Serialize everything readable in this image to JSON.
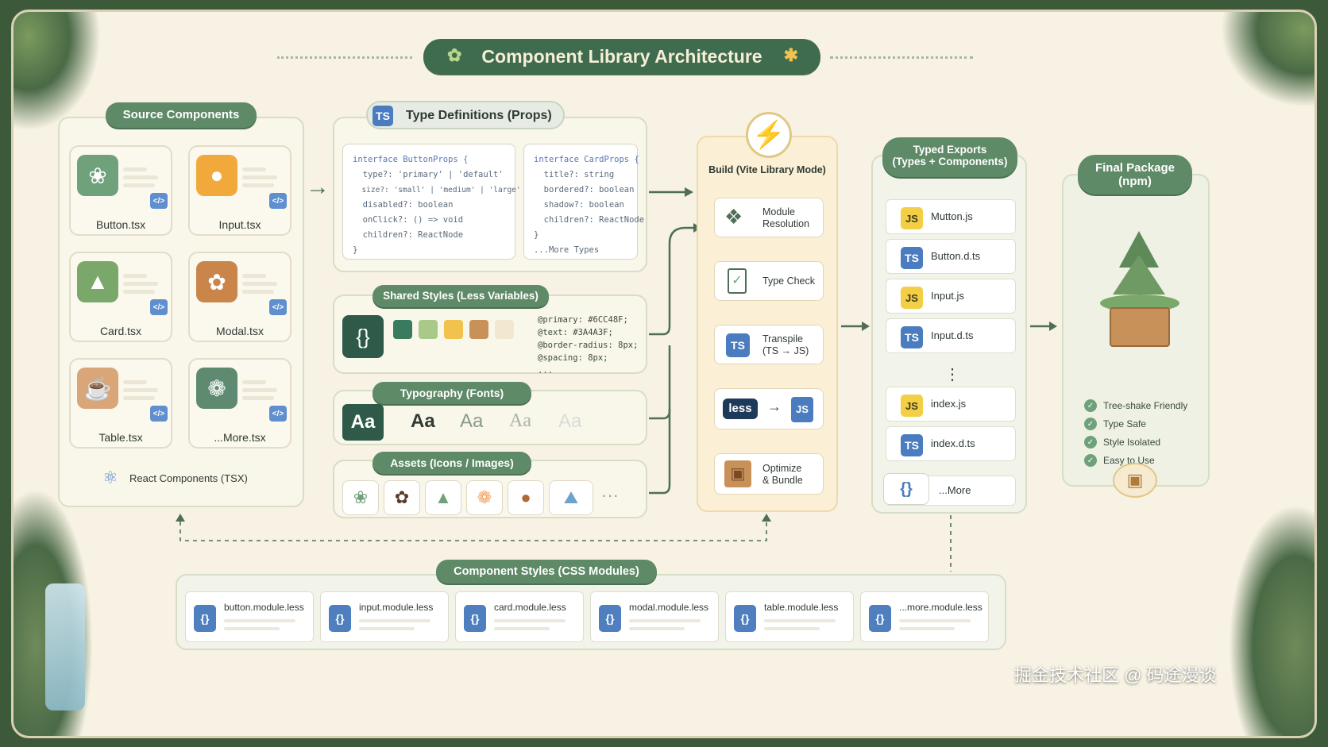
{
  "title": "Component Library Architecture",
  "source": {
    "heading": "Source Components",
    "items": [
      {
        "label": "Button.tsx",
        "icon": "leaf-icon",
        "color": "#6fa27a"
      },
      {
        "label": "Input.tsx",
        "icon": "bear-icon",
        "color": "#f2a93b"
      },
      {
        "label": "Card.tsx",
        "icon": "tree-icon",
        "color": "#7aa86a"
      },
      {
        "label": "Modal.tsx",
        "icon": "paw-icon",
        "color": "#c9854a"
      },
      {
        "label": "Table.tsx",
        "icon": "cup-icon",
        "color": "#d9a679"
      },
      {
        "label": "...More.tsx",
        "icon": "flower-icon",
        "color": "#5e8a72"
      }
    ],
    "footer": "React Components (TSX)"
  },
  "types": {
    "heading": "Type Definitions (Props)",
    "badge": "TS",
    "button_props": [
      "interface ButtonProps {",
      "  type?: 'primary' | 'default'",
      "  size?: 'small' | 'medium' | 'large'",
      "  disabled?: boolean",
      "  onClick?: () => void",
      "  children?: ReactNode",
      "}"
    ],
    "card_props": [
      "interface CardProps {",
      "  title?: string",
      "  bordered?: boolean",
      "  shadow?: boolean",
      "  children?: ReactNode",
      "}",
      "...More Types"
    ]
  },
  "shared_styles": {
    "heading": "Shared Styles (Less Variables)",
    "swatches": [
      "#3A7A5F",
      "#A9C98A",
      "#F2C24F",
      "#C9915A",
      "#F2E7CF"
    ],
    "vars": [
      "@primary: #6CC48F;",
      "@text: #3A4A3F;",
      "@border-radius: 8px;",
      "@spacing: 8px;",
      "..."
    ]
  },
  "typography": {
    "heading": "Typography (Fonts)",
    "samples": [
      "Aa",
      "Aa",
      "Aa",
      "Aa",
      "Aa"
    ]
  },
  "assets": {
    "heading": "Assets (Icons / Images)",
    "more": "···"
  },
  "build": {
    "heading": "Build (Vite Library Mode)",
    "steps": [
      {
        "label1": "Module",
        "label2": "Resolution"
      },
      {
        "label1": "Type Check",
        "label2": ""
      },
      {
        "label1": "Transpile",
        "label2": "(TS → JS)"
      },
      {
        "label1": "",
        "label2": ""
      },
      {
        "label1": "Optimize",
        "label2": "& Bundle"
      }
    ],
    "less_label": "less",
    "js_label": "JS",
    "ts_label": "TS"
  },
  "exports": {
    "heading1": "Typed Exports",
    "heading2": "(Types + Components)",
    "rows": [
      {
        "badge": "JS",
        "label": "Mutton.js"
      },
      {
        "badge": "TS",
        "label": "Button.d.ts"
      },
      {
        "badge": "JS",
        "label": "Input.js"
      },
      {
        "badge": "TS",
        "label": "Input.d.ts"
      },
      {
        "badge": "JS",
        "label": "index.js"
      },
      {
        "badge": "TS",
        "label": "index.d.ts"
      }
    ],
    "dots": "⋮",
    "more_icon": "{}",
    "more_label": "...More"
  },
  "final": {
    "heading1": "Final Package",
    "heading2": "(npm)",
    "features": [
      "Tree-shake Friendly",
      "Type Safe",
      "Style Isolated",
      "Easy to Use"
    ]
  },
  "css_modules": {
    "heading": "Component Styles (CSS Modules)",
    "files": [
      "button.module.less",
      "input.module.less",
      "card.module.less",
      "modal.module.less",
      "table.module.less",
      "...more.module.less"
    ]
  },
  "watermark": "掘金技术社区 @ 码途漫谈"
}
